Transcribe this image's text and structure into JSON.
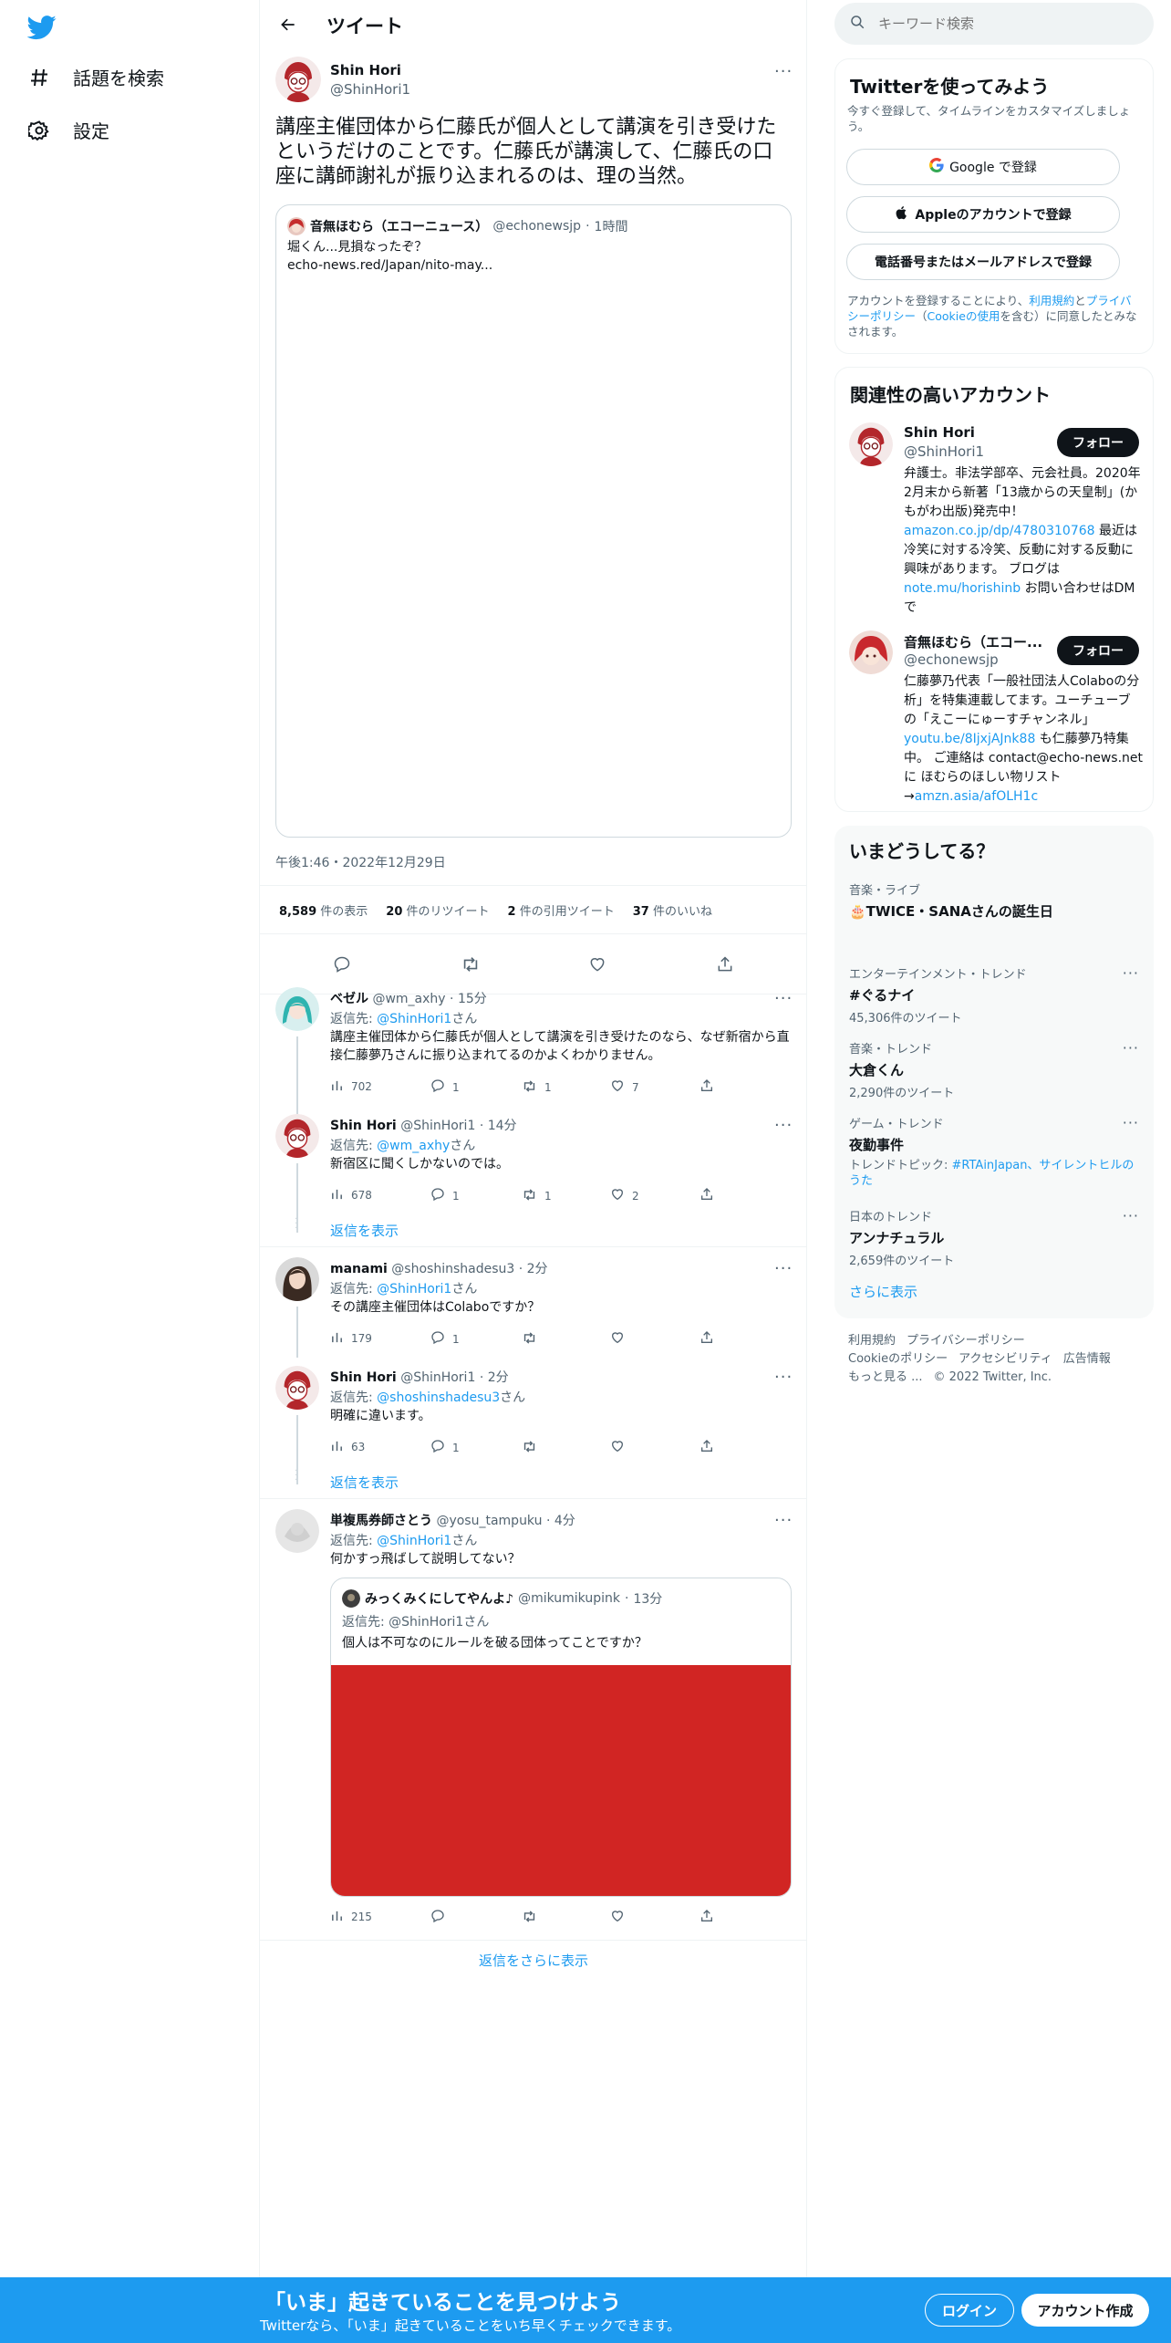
{
  "nav": {
    "explore_label": "話題を検索",
    "settings_label": "設定"
  },
  "header": {
    "title": "ツイート"
  },
  "tweet": {
    "author_name": "Shin Hori",
    "author_handle": "@ShinHori1",
    "text": "講座主催団体から仁藤氏が個人として講演を引き受けたというだけのことです。仁藤氏が講演して、仁藤氏の口座に講師謝礼が振り込まれるのは、理の当然。",
    "quote": {
      "name": "音無ほむら（エコーニュース）",
      "handle": "@echonewsjp",
      "time": "1時間",
      "line1": "堀くん...見損なったぞ？",
      "line2": "echo-news.red/Japan/nito-may..."
    },
    "timestamp": "午後1:46・2022年12月29日",
    "stats": {
      "views": "8,589",
      "views_label": "件の表示",
      "retweets": "20",
      "retweets_label": "件のリツイート",
      "quotes": "2",
      "quotes_label": "件の引用ツイート",
      "likes": "37",
      "likes_label": "件のいいね"
    }
  },
  "replies": [
    {
      "name": "ベゼル",
      "handle": "@wm_axhy",
      "time": "15分",
      "reply_label": "返信先: ",
      "reply_to": "@ShinHori1",
      "reply_suffix": "さん",
      "text": "講座主催団体から仁藤氏が個人として講演を引き受けたのなら、なぜ新宿から直接仁藤夢乃さんに振り込まれてるのかよくわかりません。",
      "views": "702",
      "replies": "1",
      "retweets": "1",
      "likes": "7"
    },
    {
      "name": "Shin Hori",
      "handle": "@ShinHori1",
      "time": "14分",
      "reply_label": "返信先: ",
      "reply_to": "@wm_axhy",
      "reply_suffix": "さん",
      "text": "新宿区に聞くしかないのでは。",
      "views": "678",
      "replies": "1",
      "retweets": "1",
      "likes": "2"
    },
    {
      "name": "manami",
      "handle": "@shoshinshadesu3",
      "time": "2分",
      "reply_label": "返信先: ",
      "reply_to": "@ShinHori1",
      "reply_suffix": "さん",
      "text": "その講座主催団体はColaboですか？",
      "views": "179",
      "replies": "1",
      "retweets": "",
      "likes": ""
    },
    {
      "name": "Shin Hori",
      "handle": "@ShinHori1",
      "time": "2分",
      "reply_label": "返信先: ",
      "reply_to": "@shoshinshadesu3",
      "reply_suffix": "さん",
      "text": "明確に違います。",
      "views": "63",
      "replies": "1",
      "retweets": "",
      "likes": ""
    },
    {
      "name": "単複馬券師さとう",
      "handle": "@yosu_tampuku",
      "time": "4分",
      "reply_label": "返信先: ",
      "reply_to": "@ShinHori1",
      "reply_suffix": "さん",
      "text": "何かすっ飛ばして説明してない？",
      "views": "215",
      "replies": "",
      "retweets": "",
      "likes": "",
      "embed": {
        "name": "みっくみくにしてやんよ♪",
        "handle": "@mikumikupink",
        "time": "13分",
        "reply_to_line": "返信先: @ShinHori1さん",
        "text": "個人は不可なのにルールを破る団体ってことですか？"
      }
    }
  ],
  "show_replies": "返信を表示",
  "more_replies": "返信をさらに表示",
  "search": {
    "placeholder": "キーワード検索"
  },
  "signup": {
    "title": "Twitterを使ってみよう",
    "subtitle": "今すぐ登録して、タイムラインをカスタマイズしましょう。",
    "google": "Google で登録",
    "apple": "Appleのアカウントで登録",
    "phone": "電話番号またはメールアドレスで登録",
    "legal_1": "アカウントを登録することにより、",
    "legal_terms": "利用規約",
    "legal_2": "と",
    "legal_privacy": "プライバシーポリシー",
    "legal_3": "（",
    "legal_cookie": "Cookieの使用",
    "legal_4": "を含む）に同意したとみなされます。"
  },
  "relevant": {
    "title": "関連性の高いアカウント",
    "follow": "フォロー",
    "accounts": [
      {
        "name": "Shin Hori",
        "handle": "@ShinHori1",
        "bio_1": "弁護士。非法学部卒、元会社員。2020年2月末から新著「13歳からの天皇制」(かもがわ出版)発売中！",
        "bio_link1": "amazon.co.jp/dp/4780310768",
        "bio_2": " 最近は冷笑に対する冷笑、反動に対する反動に興味があります。 ブログは ",
        "bio_link2": "note.mu/horishinb",
        "bio_3": " お問い合わせはDMで"
      },
      {
        "name": "音無ほむら（エコー...",
        "handle": "@echonewsjp",
        "bio_1": "仁藤夢乃代表「一般社団法人Colaboの分析」を特集連載してます。ユーチューブの「えこーにゅーすチャンネル」",
        "bio_link1": "youtu.be/8IjxjAJnk88",
        "bio_2": " も仁藤夢乃特集中。 ご連絡は contact@echo-news.net に ほむらのほしい物リスト→",
        "bio_link2": "amzn.asia/afOLH1c",
        "bio_3": ""
      }
    ]
  },
  "trends": {
    "title": "いまどうしてる？",
    "items": [
      {
        "category": "音楽・ライブ",
        "name": "🎂TWICE・SANAさんの誕生日",
        "count": ""
      },
      {
        "category": "エンターテインメント・トレンド",
        "name": "#ぐるナイ",
        "count": "45,306件のツイート"
      },
      {
        "category": "音楽・トレンド",
        "name": "大倉くん",
        "count": "2,290件のツイート"
      },
      {
        "category": "ゲーム・トレンド",
        "name": "夜勤事件",
        "count": "",
        "topics_label": "トレンドトピック: ",
        "topics": "#RTAinJapan、サイレントヒルのうた"
      },
      {
        "category": "日本のトレンド",
        "name": "アンナチュラル",
        "count": "2,659件のツイート"
      }
    ],
    "show_more": "さらに表示"
  },
  "footer": {
    "terms": "利用規約",
    "privacy": "プライバシーポリシー",
    "cookie": "Cookieのポリシー",
    "accessibility": "アクセシビリティ",
    "ads": "広告情報",
    "more": "もっと見る ...",
    "copyright": "© 2022 Twitter, Inc."
  },
  "bottom_bar": {
    "title": "「いま」起きていることを見つけよう",
    "subtitle": "Twitterなら、「いま」起きていることをいち早くチェックできます。",
    "login": "ログイン",
    "signup": "アカウント作成"
  },
  "colors": {
    "accent": "#1d9bf0",
    "text": "#0f1419",
    "muted": "#536471",
    "embed_red": "#d12523"
  }
}
